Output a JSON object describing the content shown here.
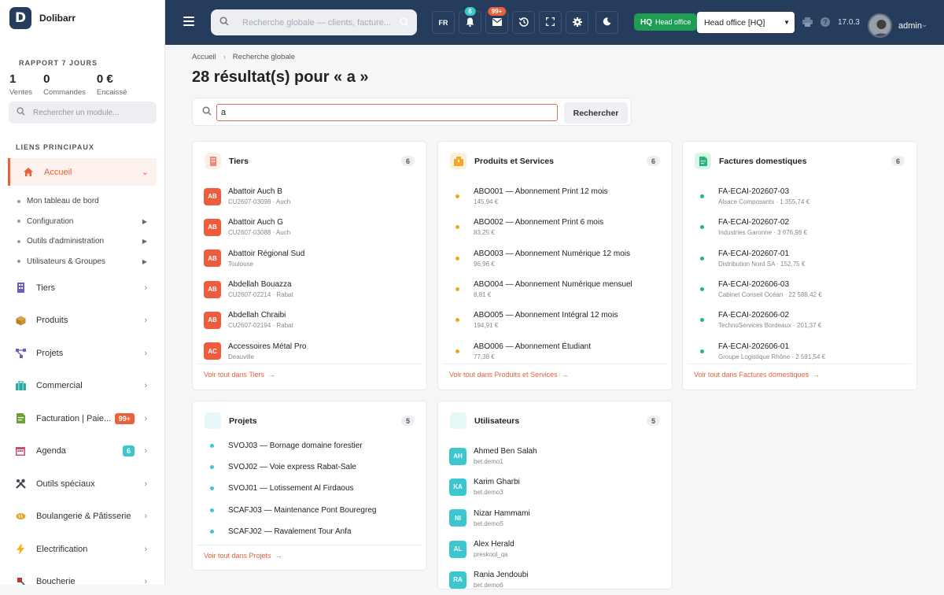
{
  "brand": {
    "logo": "D",
    "name": "Dolibarr"
  },
  "report": {
    "title": "RAPPORT 7 JOURS",
    "stats": [
      {
        "value": "1",
        "label": "Ventes"
      },
      {
        "value": "0",
        "label": "Commandes"
      },
      {
        "value": "0 €",
        "label": "Encaissé"
      }
    ]
  },
  "module_search": {
    "placeholder": "Rechercher un module..."
  },
  "links_title": "LIENS PRINCIPAUX",
  "menu": {
    "accueil": "Accueil",
    "subs": [
      "Mon tableau de bord",
      "Configuration",
      "Outils d'administration",
      "Utilisateurs & Groupes"
    ],
    "items": [
      {
        "label": "Tiers",
        "icon": "building-icon"
      },
      {
        "label": "Produits",
        "icon": "box-icon"
      },
      {
        "label": "Projets",
        "icon": "project-icon"
      },
      {
        "label": "Commercial",
        "icon": "briefcase-icon"
      },
      {
        "label": "Facturation | Paie...",
        "icon": "invoice-icon",
        "badge": "99+"
      },
      {
        "label": "Agenda",
        "icon": "calendar-icon",
        "badge": "6"
      },
      {
        "label": "Outils spéciaux",
        "icon": "tools-icon"
      },
      {
        "label": "Boulangerie & Pâtisserie",
        "icon": "bread-icon"
      },
      {
        "label": "Electrification",
        "icon": "bolt-icon"
      },
      {
        "label": "Boucherie",
        "icon": "meat-icon"
      }
    ]
  },
  "topbar": {
    "search_placeholder": "Recherche globale — clients, facture...",
    "lang": "FR",
    "notif_badge": "6",
    "mail_badge": "99+",
    "hq_code": "HQ",
    "hq_label": "Head office",
    "entity": "Head office [HQ]",
    "version": "17.0.3",
    "user": "admin"
  },
  "breadcrumb": {
    "home": "Accueil",
    "current": "Recherche globale"
  },
  "page_title": "28 résultat(s) pour « a »",
  "search": {
    "value": "a",
    "button": "Rechercher"
  },
  "colors": {
    "accent": "#e9613a",
    "topbar": "#263c5c",
    "teal": "#3cc7cf",
    "orange": "#f5a623",
    "green": "#1fb97a"
  },
  "cards": [
    {
      "title": "Tiers",
      "count": "6",
      "icon": "building-icon",
      "rows": [
        {
          "avatar": "AB",
          "title": "Abattoir Auch B",
          "sub": "CU2607-03098 · Auch"
        },
        {
          "avatar": "AB",
          "title": "Abattoir Auch G",
          "sub": "CU2607-03088 · Auch"
        },
        {
          "avatar": "AB",
          "title": "Abattoir Régional Sud",
          "sub": "Toulouse"
        },
        {
          "avatar": "AB",
          "title": "Abdellah Bouazza",
          "sub": "CU2607-02214 · Rabat"
        },
        {
          "avatar": "AB",
          "title": "Abdellah Chraibi",
          "sub": "CU2607-02194 · Rabat"
        },
        {
          "avatar": "AC",
          "title": "Accessoires Métal Pro",
          "sub": "Deauville"
        }
      ],
      "footer": "Voir tout dans Tiers"
    },
    {
      "title": "Produits et Services",
      "count": "6",
      "icon": "box-icon",
      "rows": [
        {
          "title": "ABO001 — Abonnement Print 12 mois",
          "sub": "145,94 €"
        },
        {
          "title": "ABO002 — Abonnement Print 6 mois",
          "sub": "83,25 €"
        },
        {
          "title": "ABO003 — Abonnement Numérique 12 mois",
          "sub": "96,96 €"
        },
        {
          "title": "ABO004 — Abonnement Numérique mensuel",
          "sub": "8,81 €"
        },
        {
          "title": "ABO005 — Abonnement Intégral 12 mois",
          "sub": "194,91 €"
        },
        {
          "title": "ABO006 — Abonnement Étudiant",
          "sub": "77,38 €"
        }
      ],
      "footer": "Voir tout dans Produits et Services"
    },
    {
      "title": "Factures domestiques",
      "count": "6",
      "icon": "invoice-icon",
      "rows": [
        {
          "title": "FA-ECAI-202607-03",
          "sub": "Alsace Composants · 1 355,74 €"
        },
        {
          "title": "FA-ECAI-202607-02",
          "sub": "Industries Garonne · 3 676,98 €"
        },
        {
          "title": "FA-ECAI-202607-01",
          "sub": "Distribution Nord SA · 152,75 €"
        },
        {
          "title": "FA-ECAI-202606-03",
          "sub": "Cabinet Conseil Océan · 22 588,42 €"
        },
        {
          "title": "FA-ECAI-202606-02",
          "sub": "TechnoServices Bordeaux · 201,37 €"
        },
        {
          "title": "FA-ECAI-202606-01",
          "sub": "Groupe Logistique Rhône · 2 591,54 €"
        }
      ],
      "footer": "Voir tout dans Factures domestiques"
    },
    {
      "title": "Projets",
      "count": "5",
      "icon": "project-icon",
      "rows": [
        {
          "title": "SVOJ03 — Bornage domaine forestier"
        },
        {
          "title": "SVOJ02 — Voie express Rabat-Sale"
        },
        {
          "title": "SVOJ01 — Lotissement Al Firdaous"
        },
        {
          "title": "SCAFJ03 — Maintenance Pont Bouregreg"
        },
        {
          "title": "SCAFJ02 — Ravalement Tour Anfa"
        }
      ],
      "footer": "Voir tout dans Projets"
    },
    {
      "title": "Utilisateurs",
      "count": "5",
      "icon": "user-icon",
      "rows": [
        {
          "avatar": "AH",
          "title": "Ahmed Ben Salah",
          "sub": "bet.demo1"
        },
        {
          "avatar": "KA",
          "title": "Karim Gharbi",
          "sub": "bet.demo3"
        },
        {
          "avatar": "NI",
          "title": "Nizar Hammami",
          "sub": "bet.demo5"
        },
        {
          "avatar": "AL",
          "title": "Alex Herald",
          "sub": "preskool_qa"
        },
        {
          "avatar": "RA",
          "title": "Rania Jendoubi",
          "sub": "bet.demo6"
        }
      ]
    }
  ]
}
